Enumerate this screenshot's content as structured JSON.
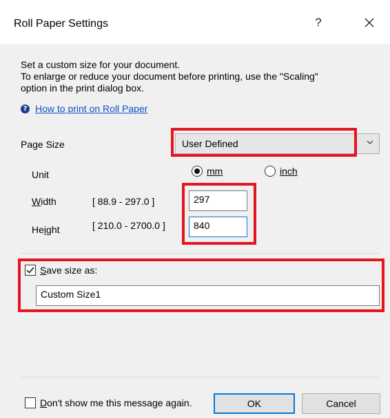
{
  "dialog": {
    "title": "Roll Paper Settings",
    "help_glyph": "?"
  },
  "description": {
    "line1": "Set a custom size for your document.",
    "line2": "To enlarge or reduce your document before printing, use the \"Scaling\"",
    "line3": "option in the print dialog box."
  },
  "help_link": "How to print on Roll Paper",
  "page_size": {
    "label": "Page Size",
    "selected": "User Defined"
  },
  "unit": {
    "label": "Unit",
    "options": [
      "mm",
      "inch"
    ],
    "selected": "mm"
  },
  "width": {
    "label_rest": "idth",
    "label_accel": "W",
    "range": "[ 88.9 - 297.0 ]",
    "value": "297"
  },
  "height": {
    "label_pre": "He",
    "label_accel": "i",
    "label_post": "ght",
    "range": "[ 210.0 - 2700.0 ]",
    "value": "840"
  },
  "save_size": {
    "checked": true,
    "label_accel": "S",
    "label_rest": "ave size as:",
    "value": "Custom Size1"
  },
  "footer": {
    "dont_show_accel": "D",
    "dont_show_rest": "on't show me this message again.",
    "dont_show_checked": false,
    "ok_label": "OK",
    "cancel_label": "Cancel"
  },
  "colors": {
    "highlight": "#e5151f",
    "link": "#0a53c6",
    "focus": "#0078d7"
  }
}
